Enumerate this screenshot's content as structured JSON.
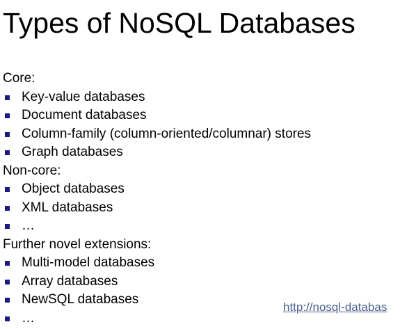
{
  "slide": {
    "title": "Types of NoSQL Databases",
    "link_text": "http://nosql-databas",
    "bullet_color": "#1a1a80",
    "link_color": "#4a5d8c"
  },
  "sections": [
    {
      "heading": "Core:",
      "items": [
        "Key-value databases",
        "Document databases",
        "Column-family (column-oriented/columnar) stores",
        "Graph databases"
      ]
    },
    {
      "heading": "Non-core:",
      "items": [
        "Object databases",
        "XML databases",
        "…"
      ]
    },
    {
      "heading": "Further novel extensions:",
      "items": [
        "Multi-model databases",
        "Array databases",
        "NewSQL databases",
        "…"
      ]
    }
  ]
}
